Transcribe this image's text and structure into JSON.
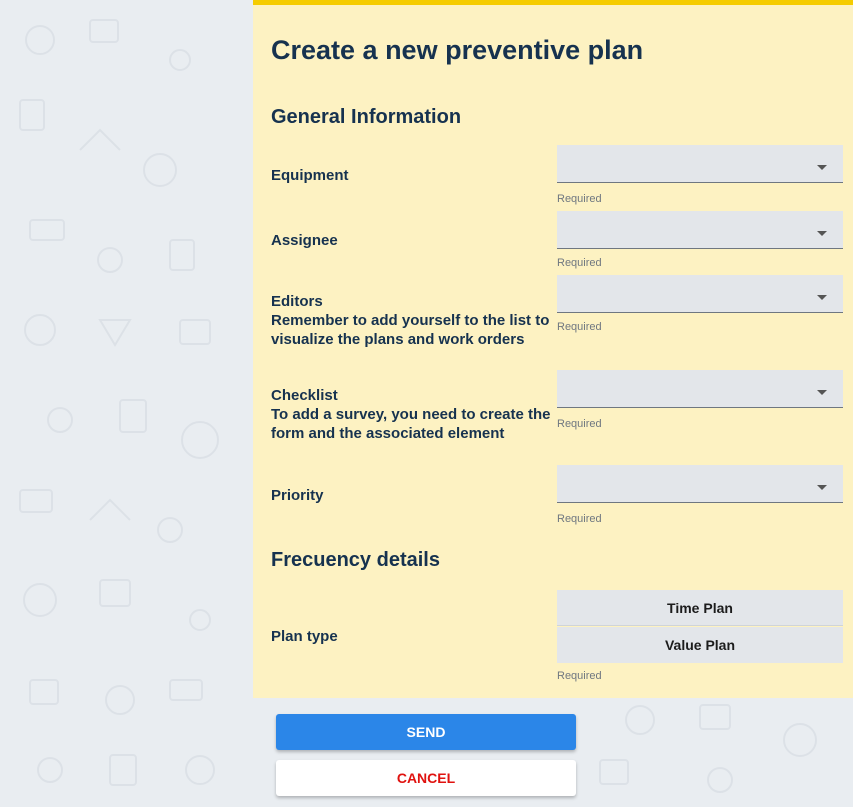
{
  "form": {
    "title": "Create a new preventive plan",
    "general_section": "General Information",
    "frequency_section": "Frecuency details",
    "fields": {
      "equipment": {
        "label": "Equipment",
        "helper": "Required",
        "value": ""
      },
      "assignee": {
        "label": "Assignee",
        "helper": "Required",
        "value": ""
      },
      "editors": {
        "label": "Editors",
        "hint": "Remember to add yourself to the list to visualize the plans and work orders",
        "helper": "Required",
        "value": ""
      },
      "checklist": {
        "label": "Checklist",
        "hint": "To add a survey, you need to create the form and the associated element",
        "helper": "Required",
        "value": ""
      },
      "priority": {
        "label": "Priority",
        "helper": "Required",
        "value": ""
      },
      "plan_type": {
        "label": "Plan type",
        "helper": "Required",
        "options": [
          "Time Plan",
          "Value Plan"
        ]
      }
    }
  },
  "actions": {
    "send_label": "SEND",
    "cancel_label": "CANCEL"
  },
  "colors": {
    "panel_bg": "#fdf2c2",
    "top_border": "#f5cc00",
    "heading": "#16324f",
    "send_bg": "#2b86e8",
    "cancel_text": "#e0120f",
    "page_bg": "#e9edf1"
  }
}
